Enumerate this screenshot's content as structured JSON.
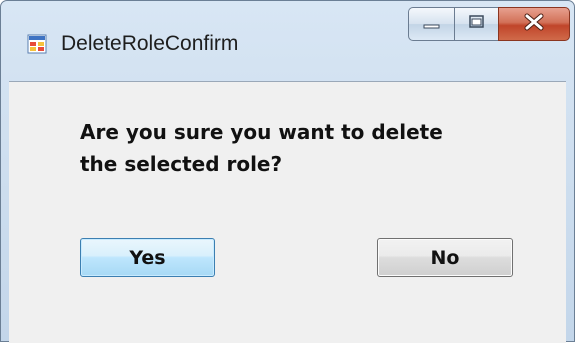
{
  "window": {
    "title": "DeleteRoleConfirm",
    "icon": "windows-form-icon"
  },
  "caption_buttons": {
    "minimize_icon": "minimize-icon",
    "maximize_icon": "maximize-icon",
    "close_icon": "close-icon"
  },
  "dialog": {
    "message_line1": "Are you sure you want to delete",
    "message_line2": "the selected role?",
    "yes_label": "Yes",
    "no_label": "No"
  },
  "colors": {
    "client_bg": "#f0f0f0",
    "close_button": "#c0452a",
    "default_button_border": "#3c7fb1"
  }
}
